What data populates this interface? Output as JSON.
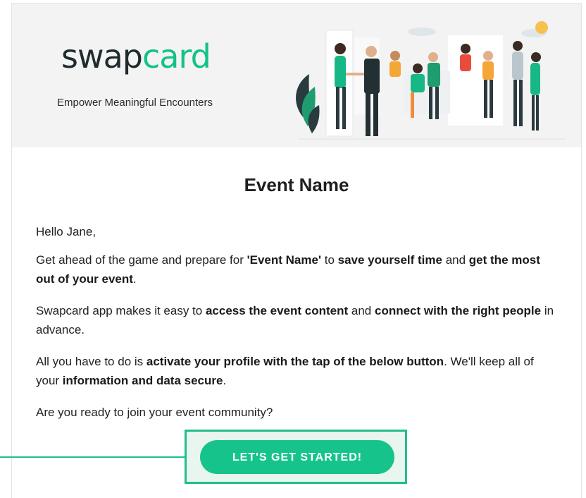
{
  "brand": {
    "logo_part1": "swap",
    "logo_part2": "card",
    "tagline": "Empower Meaningful Encounters",
    "primary_color": "#16c48b",
    "dark_color": "#1f2b2e"
  },
  "email": {
    "title": "Event Name",
    "greeting": "Hello Jane,",
    "p2": {
      "t1": "Get ahead of the game and prepare for ",
      "b1": "'Event Name'",
      "t2": " to ",
      "b2": "save yourself time",
      "t3": " and ",
      "b3": "get the most out of your event",
      "t4": "."
    },
    "p3": {
      "t1": "Swapcard app makes it easy to ",
      "b1": "access the event content",
      "t2": " and ",
      "b2": "connect with the right people",
      "t3": " in advance."
    },
    "p4": {
      "t1": "All you have to do is ",
      "b1": "activate your profile with the tap of the below button",
      "t2": ". We'll keep all of your ",
      "b2": "information and data secure",
      "t3": "."
    },
    "question": "Are you ready to join your event community?",
    "cta_label": "LET'S GET STARTED!"
  }
}
